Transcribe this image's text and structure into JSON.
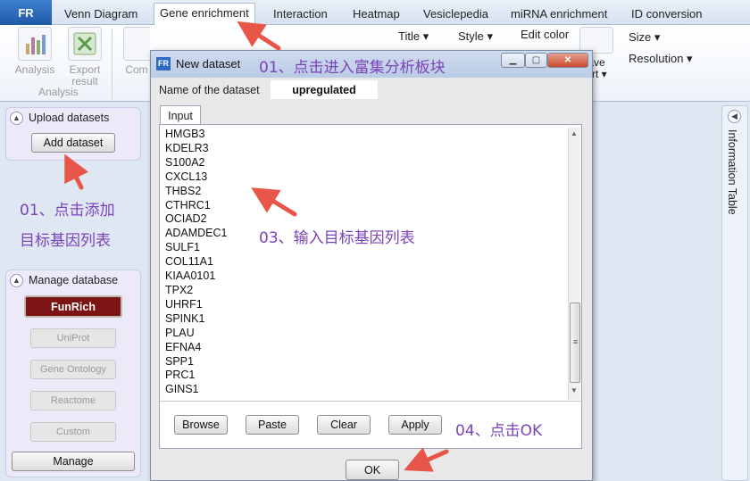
{
  "app": {
    "logo": "FR"
  },
  "tabs": [
    {
      "label": "Venn Diagram"
    },
    {
      "label": "Gene enrichment"
    },
    {
      "label": "Interaction"
    },
    {
      "label": "Heatmap"
    },
    {
      "label": "Vesiclepedia"
    },
    {
      "label": "miRNA enrichment"
    },
    {
      "label": "ID conversion"
    }
  ],
  "ribbon": {
    "analysis_btn": "Analysis",
    "export_btn_line1": "Export",
    "export_btn_line2": "result",
    "group_label": "Analysis",
    "partial_com": "Com",
    "title_menu": "Title ▾",
    "style_menu": "Style ▾",
    "edit_color": "Edit color",
    "save_chart_line1": "ave",
    "save_chart_line2": "art ▾",
    "size_menu": "Size ▾",
    "resolution_menu": "Resolution ▾"
  },
  "left_panel": {
    "upload_title": "Upload datasets",
    "add_dataset": "Add dataset",
    "manage_title": "Manage database",
    "funrich": "FunRich",
    "uniprot": "UniProt",
    "gene_ontology": "Gene Ontology",
    "reactome": "Reactome",
    "custom": "Custom",
    "manage": "Manage"
  },
  "info_panel": {
    "title": "Information Table"
  },
  "dialog": {
    "title": "New dataset",
    "logo": "FR",
    "name_label": "Name of the dataset",
    "name_value": "upregulated",
    "input_tab": "Input",
    "genes": [
      "HMGB3",
      "KDELR3",
      "S100A2",
      "CXCL13",
      "THBS2",
      "CTHRC1",
      "OCIAD2",
      "ADAMDEC1",
      "SULF1",
      "COL11A1",
      "KIAA0101",
      "TPX2",
      "UHRF1",
      "SPINK1",
      "PLAU",
      "EFNA4",
      "SPP1",
      "PRC1",
      "GINS1"
    ],
    "browse": "Browse",
    "paste": "Paste",
    "clear": "Clear",
    "apply": "Apply",
    "ok": "OK"
  },
  "annotations": {
    "step1_tab": "01、点击进入富集分析板块",
    "step1_add_line1": "01、点击添加",
    "step1_add_line2": "目标基因列表",
    "step3": "03、输入目标基因列表",
    "step4": "04、点击OK",
    "color": "#7b43b8",
    "arrow_color": "#e8564a"
  }
}
